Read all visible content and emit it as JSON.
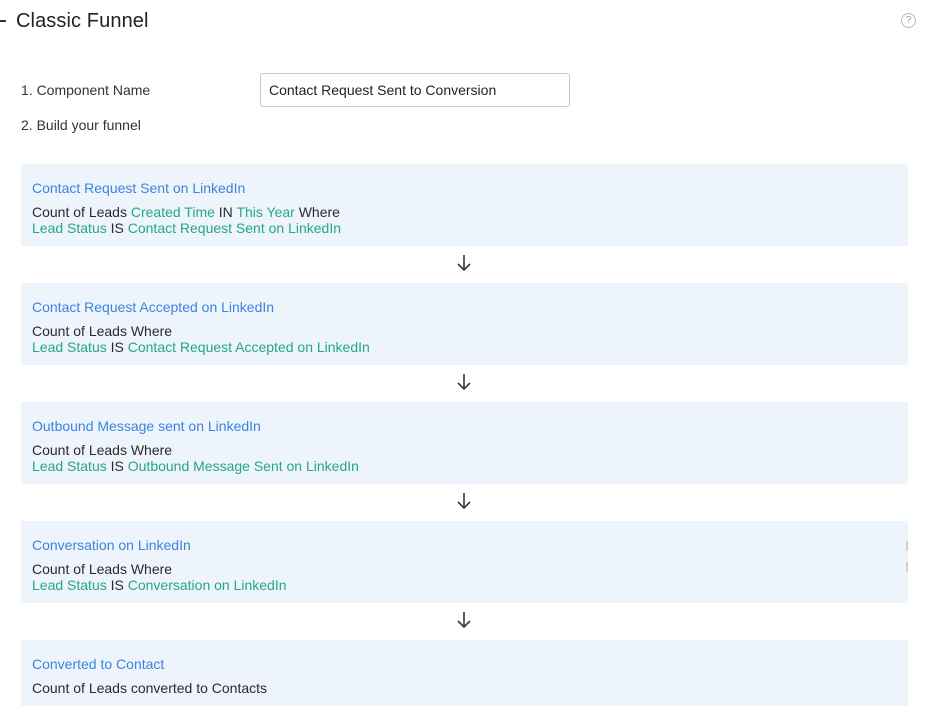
{
  "header": {
    "title": "Classic Funnel",
    "help_icon": "question-circle-icon",
    "help_glyph": "?"
  },
  "form": {
    "component_name_label": "1. Component Name",
    "component_name_value": "Contact Request Sent to Conversion",
    "build_label": "2. Build your funnel"
  },
  "colors": {
    "link_blue": "#3c84dc",
    "field_green": "#26a68a",
    "stage_bg": "#eef4fb",
    "arrow": "#2f3a46"
  },
  "stages": [
    {
      "name": "Contact Request Sent on LinkedIn",
      "line1": {
        "prefix": "Count of Leads",
        "field": "Created Time",
        "op": "IN",
        "value": "This Year",
        "suffix": "Where"
      },
      "line2": {
        "field": "Lead Status",
        "op": "IS",
        "value": "Contact Request Sent on LinkedIn"
      }
    },
    {
      "name": "Contact Request Accepted on LinkedIn",
      "line1": {
        "prefix": "Count of Leads Where"
      },
      "line2": {
        "field": "Lead Status",
        "op": "IS",
        "value": "Contact Request Accepted on LinkedIn"
      }
    },
    {
      "name": "Outbound Message sent on LinkedIn",
      "line1": {
        "prefix": "Count of Leads Where"
      },
      "line2": {
        "field": "Lead Status",
        "op": "IS",
        "value": "Outbound Message Sent on LinkedIn"
      }
    },
    {
      "name": "Conversation on LinkedIn",
      "line1": {
        "prefix": "Count of Leads Where"
      },
      "line2": {
        "field": "Lead Status",
        "op": "IS",
        "value": "Conversation on LinkedIn"
      }
    },
    {
      "name": "Converted to Contact",
      "line1": {
        "prefix": "Count of Leads converted to Contacts"
      }
    }
  ],
  "connector_icon": "arrow-down-icon"
}
